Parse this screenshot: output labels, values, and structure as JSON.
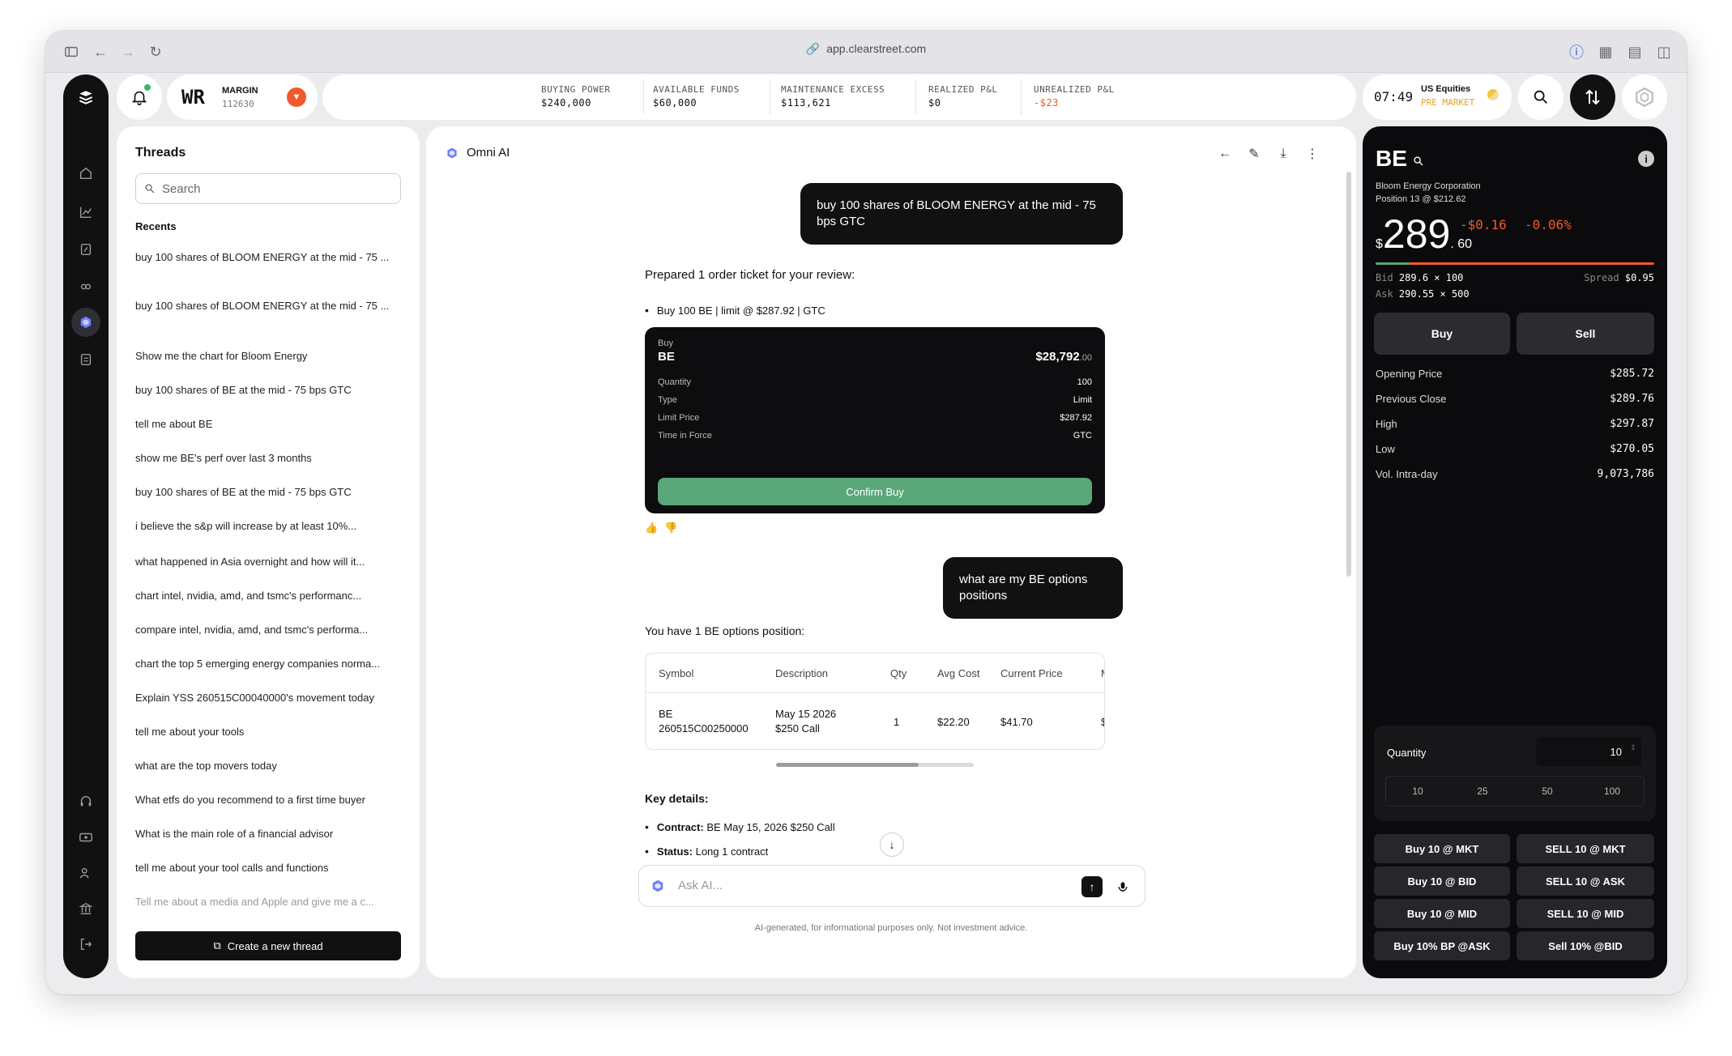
{
  "browser": {
    "url": "app.clearstreet.com"
  },
  "account": {
    "initials": "WR",
    "type": "MARGIN",
    "id": "112630"
  },
  "stats": [
    {
      "label": "BUYING POWER",
      "value": "$240,000"
    },
    {
      "label": "AVAILABLE FUNDS",
      "value": "$60,000"
    },
    {
      "label": "MAINTENANCE EXCESS",
      "value": "$113,621"
    },
    {
      "label": "REALIZED P&L",
      "value": "$0"
    },
    {
      "label": "UNREALIZED P&L",
      "value": "-$23"
    }
  ],
  "clock": {
    "time": "07:49",
    "market": "US Equities",
    "session": "PRE MARKET"
  },
  "threads": {
    "title": "Threads",
    "search_placeholder": "Search",
    "recents_label": "Recents",
    "items": [
      "buy 100 shares of BLOOM ENERGY at the mid - 75 ...",
      "buy 100 shares of BLOOM ENERGY at the mid - 75 ...",
      "Show me the chart for Bloom Energy",
      "buy 100 shares of BE at the mid - 75 bps GTC",
      "tell me about BE",
      "show me BE's perf over last 3 months",
      "buy 100 shares of BE at the mid - 75 bps GTC",
      "i believe the s&p will increase by at least 10%...",
      "what happened in Asia overnight and how will it...",
      "chart intel, nvidia, amd, and tsmc's performanc...",
      "compare intel, nvidia, amd, and tsmc's performa...",
      "chart the top 5 emerging energy companies norma...",
      "Explain YSS 260515C00040000's movement today",
      "tell me about your tools",
      "what are the top movers today",
      "What etfs do you recommend to a first time buyer",
      "What is the main role of a financial advisor",
      "tell me about your tool calls and functions",
      "Tell me about a media and Apple and give me a c..."
    ],
    "new_thread": "Create a new thread"
  },
  "chat": {
    "title": "Omni AI",
    "user_msg_1": "buy 100 shares of BLOOM ENERGY at the mid - 75 bps GTC",
    "ai_prepared": "Prepared 1 order ticket for your review:",
    "ai_bullet": "Buy 100 BE | limit @ $287.92 | GTC",
    "ticket": {
      "side": "Buy",
      "symbol": "BE",
      "total": "$28,792",
      "total_cents": ".00",
      "rows": [
        {
          "k": "Quantity",
          "v": "100"
        },
        {
          "k": "Type",
          "v": "Limit"
        },
        {
          "k": "Limit Price",
          "v": "$287.92"
        },
        {
          "k": "Time in Force",
          "v": "GTC"
        }
      ],
      "confirm": "Confirm Buy"
    },
    "user_msg_2": "what are my BE options positions",
    "ai_positions": "You have 1 BE options position:",
    "table": {
      "headers": [
        "Symbol",
        "Description",
        "Qty",
        "Avg Cost",
        "Current Price",
        "M"
      ],
      "row": {
        "symbol_a": "BE",
        "symbol_b": "260515C00250000",
        "desc_a": "May 15 2026",
        "desc_b": "$250 Call",
        "qty": "1",
        "avg": "$22.20",
        "cur": "$41.70",
        "more": "$"
      }
    },
    "key_details": "Key details:",
    "contract_label": "Contract:",
    "contract_value": "BE May 15, 2026 $250 Call",
    "status_label": "Status:",
    "status_value": "Long 1 contract",
    "ask_placeholder": "Ask AI...",
    "disclaimer": "AI-generated, for informational purposes only. Not investment advice."
  },
  "quote": {
    "symbol": "BE",
    "name": "Bloom Energy Corporation",
    "position": "Position 13 @ $212.62",
    "currency": "$",
    "price_int": "289",
    "price_dec": ". 60",
    "change": "-$0.16",
    "change_pct": "-0.06%",
    "bid_label": "Bid",
    "bid": "289.6 × 100",
    "ask_label": "Ask",
    "ask": "290.55 × 500",
    "spread_label": "Spread",
    "spread": "$0.95",
    "buy": "Buy",
    "sell": "Sell",
    "stats": [
      {
        "k": "Opening Price",
        "v": "$285.72"
      },
      {
        "k": "Previous Close",
        "v": "$289.76"
      },
      {
        "k": "High",
        "v": "$297.87"
      },
      {
        "k": "Low",
        "v": "$270.05"
      },
      {
        "k": "Vol. Intra-day",
        "v": "9,073,786"
      }
    ],
    "quantity_label": "Quantity",
    "quantity_value": "10",
    "quantity_options": [
      "10",
      "25",
      "50",
      "100"
    ],
    "quick": [
      [
        "Buy 10 @ MKT",
        "SELL 10 @ MKT"
      ],
      [
        "Buy 10 @ BID",
        "SELL 10 @ ASK"
      ],
      [
        "Buy 10 @ MID",
        "SELL 10 @ MID"
      ],
      [
        "Buy 10% BP @ASK",
        "Sell 10% @BID"
      ]
    ]
  },
  "colors": {
    "accent_green": "#5aa77a",
    "negative": "#f0592b",
    "pre_market": "#e8a323"
  }
}
